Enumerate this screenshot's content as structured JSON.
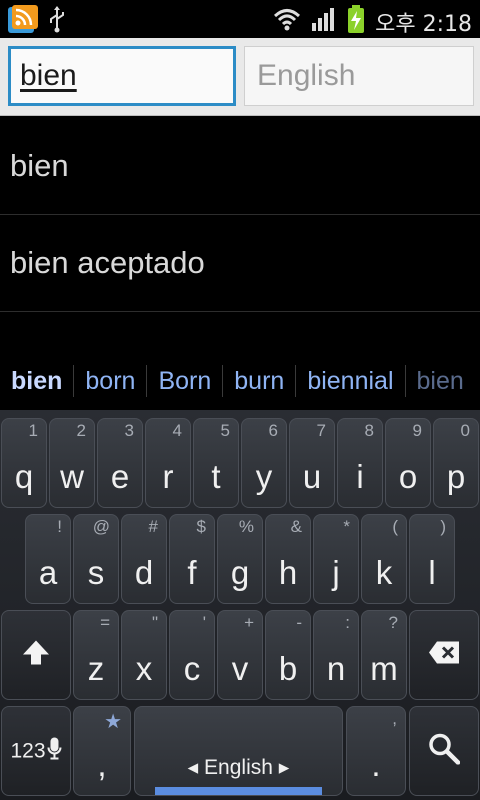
{
  "status_bar": {
    "time": "오후 2:18",
    "icons": [
      "rss-feed-icon",
      "usb-icon",
      "wifi-icon",
      "signal-icon",
      "battery-charging-icon"
    ]
  },
  "search": {
    "source_value": "bien",
    "target_placeholder": "English"
  },
  "results": [
    "bien",
    "bien aceptado"
  ],
  "suggestions": [
    "bien",
    "born",
    "Born",
    "burn",
    "biennial",
    "bien"
  ],
  "keyboard": {
    "row1": [
      {
        "main": "q",
        "sub": "1"
      },
      {
        "main": "w",
        "sub": "2"
      },
      {
        "main": "e",
        "sub": "3"
      },
      {
        "main": "r",
        "sub": "4"
      },
      {
        "main": "t",
        "sub": "5"
      },
      {
        "main": "y",
        "sub": "6"
      },
      {
        "main": "u",
        "sub": "7"
      },
      {
        "main": "i",
        "sub": "8"
      },
      {
        "main": "o",
        "sub": "9"
      },
      {
        "main": "p",
        "sub": "0"
      }
    ],
    "row2": [
      {
        "main": "a",
        "sub": "!"
      },
      {
        "main": "s",
        "sub": "@"
      },
      {
        "main": "d",
        "sub": "#"
      },
      {
        "main": "f",
        "sub": "$"
      },
      {
        "main": "g",
        "sub": "%"
      },
      {
        "main": "h",
        "sub": "&"
      },
      {
        "main": "j",
        "sub": "*"
      },
      {
        "main": "k",
        "sub": "("
      },
      {
        "main": "l",
        "sub": ")"
      }
    ],
    "row3": [
      {
        "main": "z",
        "sub": "="
      },
      {
        "main": "x",
        "sub": "\""
      },
      {
        "main": "c",
        "sub": "'"
      },
      {
        "main": "v",
        "sub": "+"
      },
      {
        "main": "b",
        "sub": "-"
      },
      {
        "main": "n",
        "sub": ":"
      },
      {
        "main": "m",
        "sub": "?"
      }
    ],
    "sym_label": "123",
    "comma_main": ",",
    "comma_sub": "★",
    "space_label": "◂ English ▸",
    "period_main": ".",
    "period_sub": ","
  },
  "colors": {
    "focus_border": "#2c8cc6",
    "suggestion": "#8fb4f4",
    "space_indicator": "#5b8de0"
  }
}
